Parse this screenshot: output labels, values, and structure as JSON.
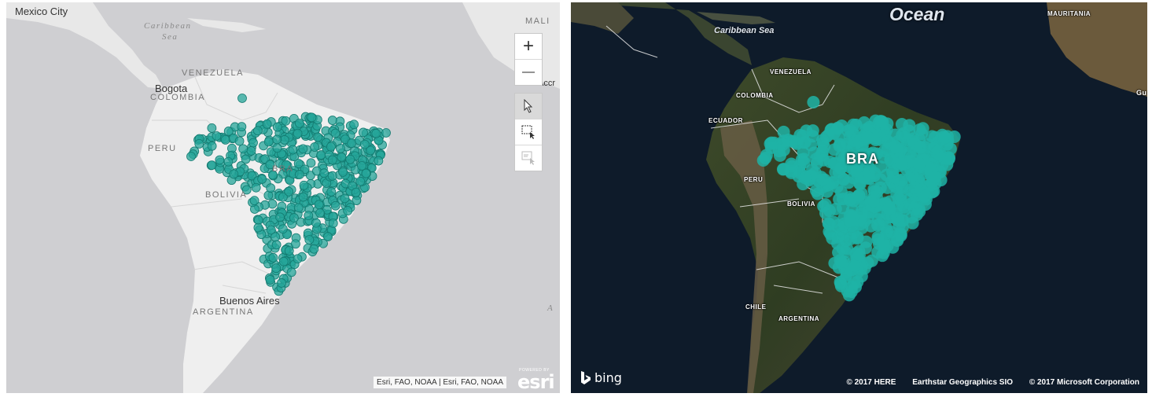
{
  "esri_map": {
    "labels": {
      "mexico_city": "Mexico City",
      "caribbean_sea": "Caribbean",
      "caribbean_sea2": "Sea",
      "venezuela": "VENEZUELA",
      "bogota": "Bogota",
      "colombia": "COLOMBIA",
      "peru": "PERU",
      "brazil": "BRA",
      "bolivia": "BOLIVIA",
      "buenos_aires": "Buenos Aires",
      "argentina": "ARGENTINA",
      "mali": "MALI",
      "accra": "Accr",
      "atlantic_fragment": "A"
    },
    "toolbar": {
      "zoom_in": "+",
      "zoom_out": "—",
      "select": "pointer",
      "rect_select": "rectangle-select",
      "lasso_select": "lasso-select"
    },
    "attribution": "Esri, FAO, NOAA | Esri, FAO, NOAA",
    "logo_top": "POWERED BY",
    "logo_word": "esri",
    "marker_color": "#26a69a",
    "marker_stroke": "#137a70"
  },
  "bing_map": {
    "labels": {
      "ocean": "Ocean",
      "caribbean_sea": "Caribbean Sea",
      "mauritania": "MAURITANIA",
      "venezuela": "VENEZUELA",
      "colombia": "COLOMBIA",
      "ecuador": "ECUADOR",
      "peru": "PERU",
      "brazil": "BRA",
      "bolivia": "BOLIVIA",
      "chile": "CHILE",
      "argentina": "ARGENTINA",
      "guinea_fragment": "Gu"
    },
    "logo": "bing",
    "attribution": [
      "© 2017 HERE",
      "Earthstar Geographics SIO",
      "© 2017 Microsoft Corporation"
    ],
    "marker_color": "#1fb3a6"
  }
}
